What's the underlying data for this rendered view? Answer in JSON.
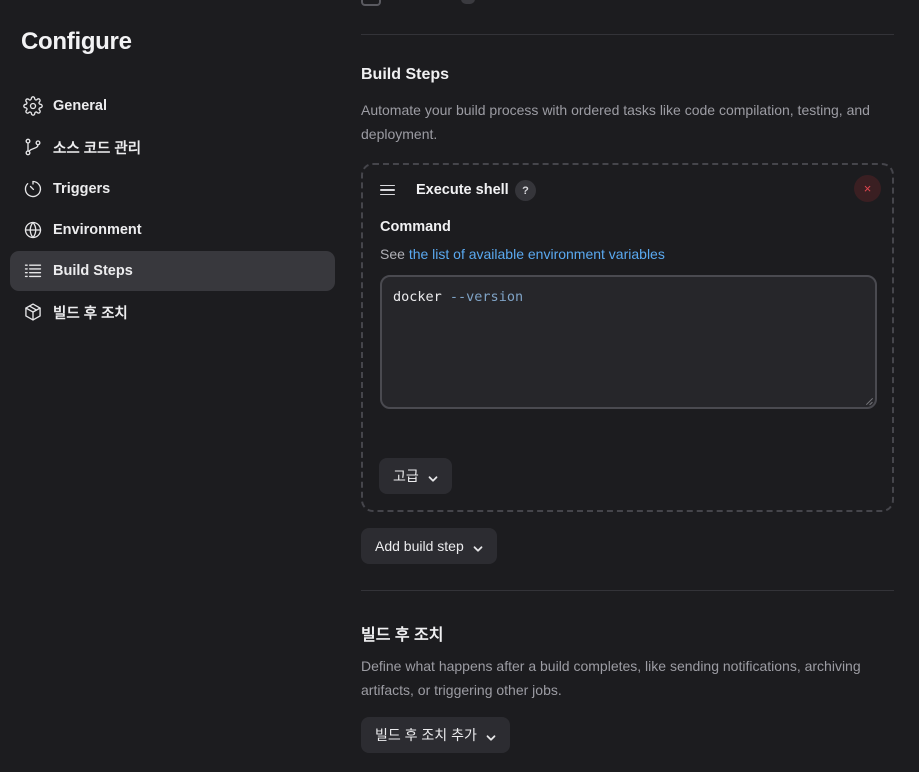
{
  "sidebar": {
    "title": "Configure",
    "items": [
      {
        "label": "General",
        "icon": "gear-icon"
      },
      {
        "label": "소스 코드 관리",
        "icon": "git-branch-icon"
      },
      {
        "label": "Triggers",
        "icon": "timer-icon"
      },
      {
        "label": "Environment",
        "icon": "globe-icon"
      },
      {
        "label": "Build Steps",
        "icon": "list-icon",
        "active": true
      },
      {
        "label": "빌드 후 조치",
        "icon": "package-icon"
      }
    ]
  },
  "build_steps": {
    "title": "Build Steps",
    "description": "Automate your build process with ordered tasks like code compilation, testing, and deployment.",
    "step": {
      "title": "Execute shell",
      "help": "?",
      "remove": "×",
      "command_label": "Command",
      "hint_prefix": "See ",
      "hint_link": "the list of available environment variables",
      "command_main": "docker",
      "command_arg": "--version",
      "advanced_button": "고급"
    },
    "add_button": "Add build step"
  },
  "post_build": {
    "title": "빌드 후 조치",
    "description": "Define what happens after a build completes, like sending notifications, archiving artifacts, or triggering other jobs.",
    "add_button": "빌드 후 조치 추가"
  }
}
